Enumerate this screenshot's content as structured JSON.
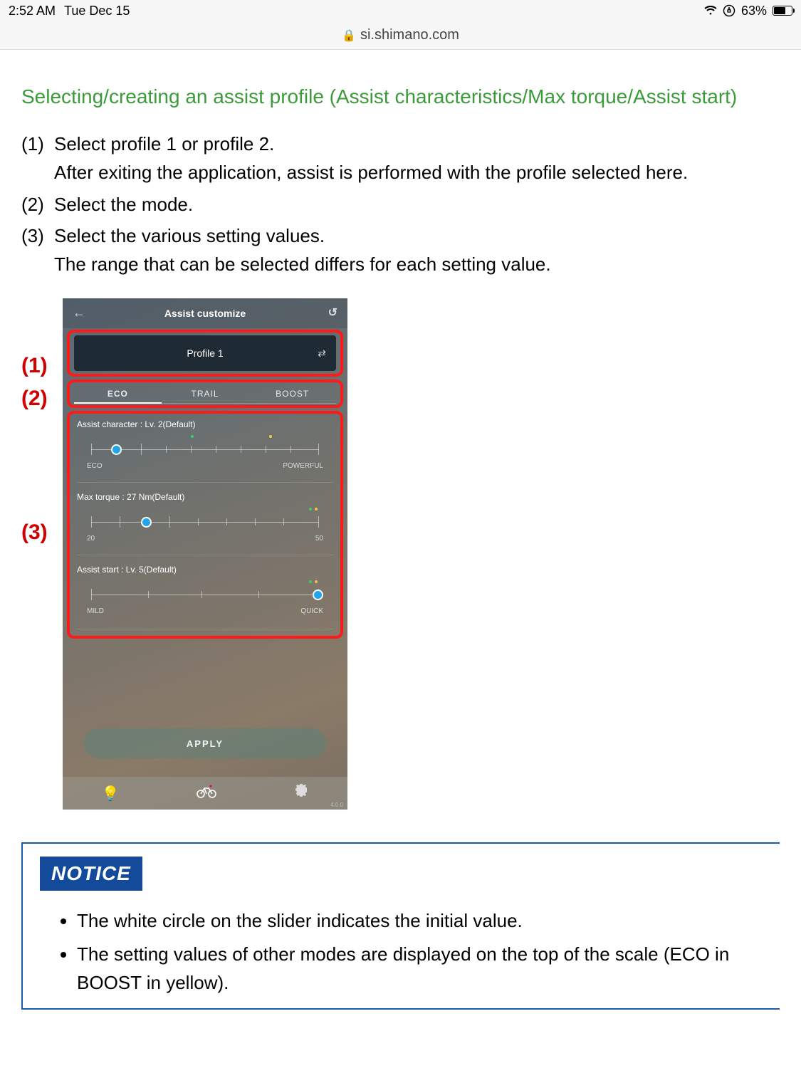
{
  "status": {
    "time": "2:52 AM",
    "date": "Tue Dec 15",
    "battery_pct": "63%"
  },
  "browser": {
    "domain": "si.shimano.com"
  },
  "section_title": "Selecting/creating an assist profile (Assist characteristics/Max torque/Assist start)",
  "steps": [
    {
      "num": "(1)",
      "lines": [
        "Select profile 1 or profile 2.",
        "After exiting the application, assist is performed with the profile selected here."
      ]
    },
    {
      "num": "(2)",
      "lines": [
        "Select the mode."
      ]
    },
    {
      "num": "(3)",
      "lines": [
        "Select the various setting values.",
        "The range that can be selected differs for each setting value."
      ]
    }
  ],
  "callouts": {
    "c1": "(1)",
    "c2": "(2)",
    "c3": "(3)"
  },
  "app": {
    "header_title": "Assist customize",
    "profile_label": "Profile 1",
    "tabs": {
      "eco": "ECO",
      "trail": "TRAIL",
      "boost": "BOOST"
    },
    "slider1": {
      "label": "Assist character : Lv. 2(Default)",
      "left": "ECO",
      "right": "POWERFUL"
    },
    "slider2": {
      "label": "Max torque : 27 Nm(Default)",
      "left": "20",
      "right": "50"
    },
    "slider3": {
      "label": "Assist start : Lv. 5(Default)",
      "left": "MILD",
      "right": "QUICK"
    },
    "apply": "APPLY",
    "version": "4.0.0"
  },
  "notice": {
    "badge": "NOTICE",
    "items": [
      "The white circle on the slider indicates the initial value.",
      "The setting values of other modes are displayed on the top of the scale (ECO in BOOST in yellow)."
    ]
  }
}
